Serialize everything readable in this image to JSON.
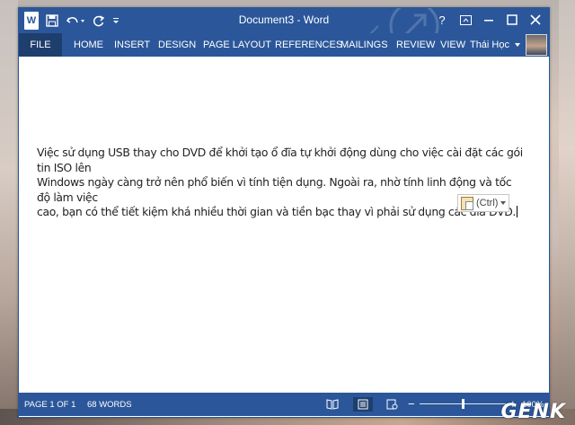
{
  "window": {
    "title": "Document3 - Word",
    "app_icon": "word-icon"
  },
  "quick_access": {
    "save_icon": "save-icon",
    "undo_icon": "undo-icon",
    "redo_icon": "repeat-icon",
    "customize_icon": "customize-qat-icon"
  },
  "window_controls": {
    "help": "?",
    "ribbon_display": "ribbon-display-icon",
    "minimize": "minimize-icon",
    "maximize": "maximize-icon",
    "close": "close-icon"
  },
  "ribbon": {
    "tabs": [
      {
        "label": "FILE"
      },
      {
        "label": "HOME"
      },
      {
        "label": "INSERT"
      },
      {
        "label": "DESIGN"
      },
      {
        "label": "PAGE LAYOUT"
      },
      {
        "label": "REFERENCES"
      },
      {
        "label": "MAILINGS"
      },
      {
        "label": "REVIEW"
      },
      {
        "label": "VIEW"
      }
    ],
    "user_name": "Thái Học"
  },
  "document": {
    "line1": "Việc sử dụng USB thay cho DVD để khởi tạo ổ đĩa tự khởi động dùng cho việc cài đặt các gói tin ISO lên",
    "line2": "Windows ngày càng trở nên phổ biến vì tính tiện dụng. Ngoài ra, nhờ tính linh động và tốc độ làm việc",
    "line3": "cao, bạn có thể tiết kiệm khá nhiều thời gian và tiền bạc thay vì phải sử dụng các đĩa DVD."
  },
  "paste_options": {
    "label": "(Ctrl)"
  },
  "status_bar": {
    "page": "PAGE 1 OF 1",
    "words": "68 WORDS",
    "zoom": "100%",
    "zoom_level": 1.0
  },
  "watermark": {
    "text": "GENK"
  },
  "colors": {
    "accent": "#2b579a"
  }
}
